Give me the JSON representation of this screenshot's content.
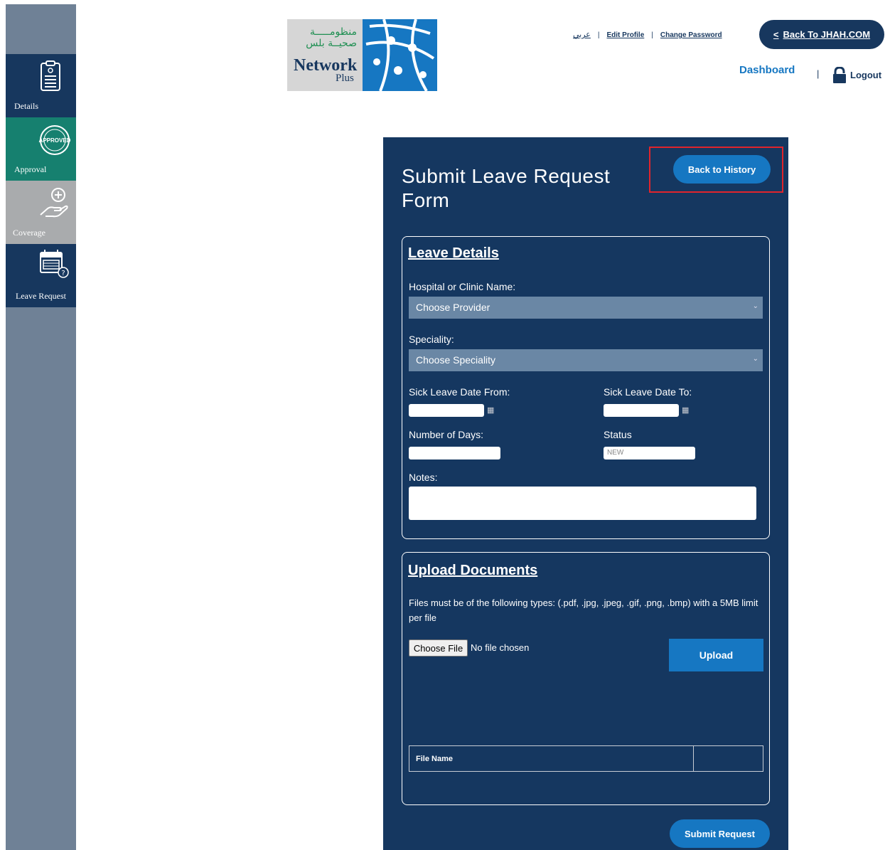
{
  "sidebar": {
    "items": [
      {
        "label": "Details",
        "icon": "document-icon"
      },
      {
        "label": "Approval",
        "icon": "approved-stamp-icon",
        "stamp_text": "APPROVED"
      },
      {
        "label": "Coverage",
        "icon": "hand-plus-icon"
      },
      {
        "label": "Leave Request",
        "icon": "calendar-question-icon"
      }
    ]
  },
  "header": {
    "logo": {
      "arabic_line1": "منظومـــــة",
      "arabic_line2": "صحيــة بلس",
      "name": "Network",
      "sub": "Plus"
    },
    "links": {
      "arabic": "عربي",
      "edit_profile": "Edit Profile",
      "change_password": "Change Password"
    },
    "back_button": {
      "chevron": "<",
      "label": "Back To JHAH.COM"
    },
    "dashboard": "Dashboard",
    "pipe": "|",
    "logout": "Logout"
  },
  "form": {
    "title": "Submit Leave Request Form",
    "back_history": "Back to History",
    "leave_details": {
      "title": "Leave Details",
      "hospital_label": "Hospital or Clinic Name:",
      "hospital_value": "Choose Provider",
      "speciality_label": "Speciality:",
      "speciality_value": "Choose Speciality",
      "date_from_label": "Sick Leave Date From:",
      "date_to_label": "Sick Leave Date To:",
      "days_label": "Number of Days:",
      "status_label": "Status",
      "status_value": "NEW",
      "notes_label": "Notes:"
    },
    "upload": {
      "title": "Upload Documents",
      "note": "Files must be of the following types: (.pdf, .jpg, .jpeg, .gif, .png, .bmp) with a 5MB limit per file",
      "choose_file": "Choose File",
      "no_file": "No file chosen",
      "upload_button": "Upload",
      "table_header": "File Name"
    },
    "submit": "Submit Request"
  },
  "colors": {
    "navy": "#17375e",
    "panel": "#153760",
    "blue": "#1677c2",
    "green": "#16806f",
    "highlight": "#e0242c"
  }
}
